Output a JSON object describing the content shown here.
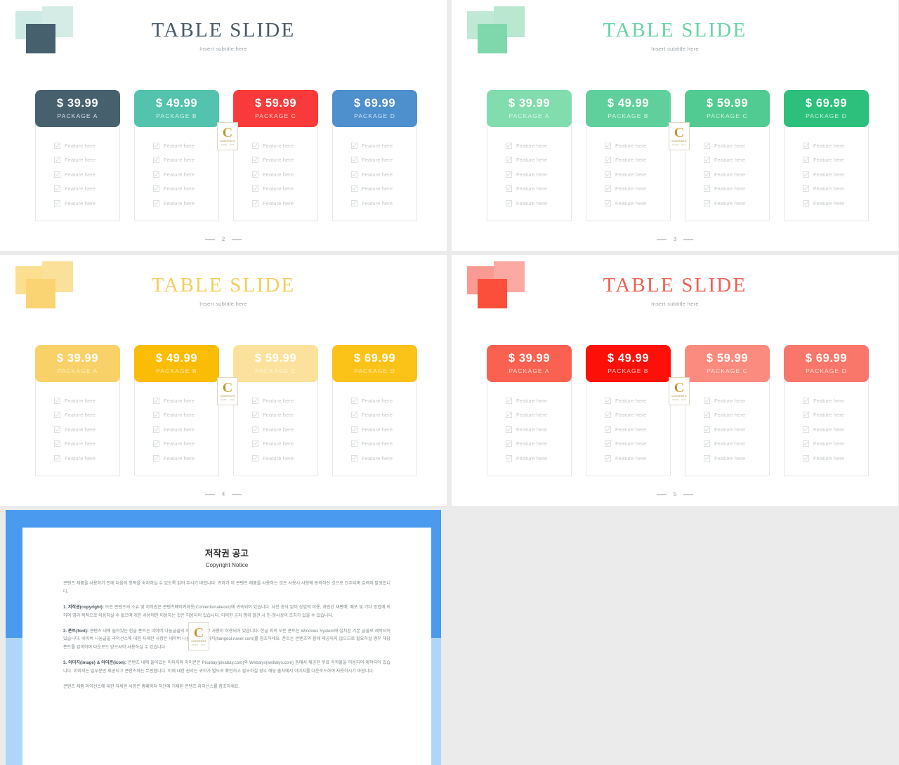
{
  "deck": {
    "subtitle": "Insert subtitle here",
    "title": "TABLE SLIDE",
    "feature_label": "Feature here",
    "watermark": {
      "letter": "C",
      "line1": "CONTENTS",
      "line2": "MAKE · OUT"
    }
  },
  "slides": [
    {
      "id": "slide-2",
      "page": "2",
      "title": "TABLE SLIDE",
      "subtitle": "Insert subtitle here",
      "title_color": "#4a5a66",
      "deco": {
        "a": "#cdeae4",
        "b": "#d5ece6",
        "c": "#47606e"
      },
      "cards": [
        {
          "price": "$ 39.99",
          "package": "PACKAGE  A",
          "bg": "#47606e",
          "pkg_color": "#d8e2e7"
        },
        {
          "price": "$ 49.99",
          "package": "PACKAGE  B",
          "bg": "#53c3ad",
          "pkg_color": "#d9f3ed"
        },
        {
          "price": "$ 59.99",
          "package": "PACKAGE  C",
          "bg": "#f93a3a",
          "pkg_color": "#ffd5d5"
        },
        {
          "price": "$ 69.99",
          "package": "PACKAGE  D",
          "bg": "#4e8fce",
          "pkg_color": "#d6e7f5"
        }
      ],
      "features": [
        "Feature here",
        "Feature here",
        "Feature here",
        "Feature here",
        "Feature here"
      ]
    },
    {
      "id": "slide-3",
      "page": "3",
      "title": "TABLE SLIDE",
      "subtitle": "Insert subtitle here",
      "title_color": "#67d3a4",
      "deco": {
        "a": "#bfe9d4",
        "b": "#b9e7d0",
        "c": "#7fd8ab"
      },
      "cards": [
        {
          "price": "$ 39.99",
          "package": "PACKAGE  A",
          "bg": "#81dcae",
          "pkg_color": "#dcf7ea"
        },
        {
          "price": "$ 49.99",
          "package": "PACKAGE  B",
          "bg": "#5fd09c",
          "pkg_color": "#d8f5e6"
        },
        {
          "price": "$ 59.99",
          "package": "PACKAGE  C",
          "bg": "#51cb92",
          "pkg_color": "#d6f4e2"
        },
        {
          "price": "$ 69.99",
          "package": "PACKAGE  D",
          "bg": "#2cc07c",
          "pkg_color": "#cff0df"
        }
      ],
      "features": [
        "Feature here",
        "Feature here",
        "Feature here",
        "Feature here",
        "Feature here"
      ]
    },
    {
      "id": "slide-4",
      "page": "4",
      "title": "TABLE SLIDE",
      "subtitle": "Insert subtitle here",
      "title_color": "#f5cd5c",
      "deco": {
        "a": "#fbdf8f",
        "b": "#fbe099",
        "c": "#fad472"
      },
      "cards": [
        {
          "price": "$ 39.99",
          "package": "PACKAGE  A",
          "bg": "#f8d268",
          "pkg_color": "#fdeec2"
        },
        {
          "price": "$ 49.99",
          "package": "PACKAGE  B",
          "bg": "#fbbc06",
          "pkg_color": "#fde8b2"
        },
        {
          "price": "$ 59.99",
          "package": "PACKAGE  C",
          "bg": "#fbe19b",
          "pkg_color": "#fef5d9"
        },
        {
          "price": "$ 69.99",
          "package": "PACKAGE  D",
          "bg": "#fbc218",
          "pkg_color": "#fdeab9"
        }
      ],
      "features": [
        "Feature here",
        "Feature here",
        "Feature here",
        "Feature here",
        "Feature here"
      ]
    },
    {
      "id": "slide-5",
      "page": "5",
      "title": "TABLE SLIDE",
      "subtitle": "Insert subtitle here",
      "title_color": "#f06055",
      "deco": {
        "a": "#fa9a93",
        "b": "#fba9a2",
        "c": "#fb4f3c"
      },
      "cards": [
        {
          "price": "$ 39.99",
          "package": "PACKAGE  A",
          "bg": "#fa6151",
          "pkg_color": "#ffd9d3"
        },
        {
          "price": "$ 49.99",
          "package": "PACKAGE  B",
          "bg": "#fc1007",
          "pkg_color": "#ffc9c5"
        },
        {
          "price": "$ 59.99",
          "package": "PACKAGE  C",
          "bg": "#fa8b7e",
          "pkg_color": "#ffe2dc"
        },
        {
          "price": "$ 69.99",
          "package": "PACKAGE  D",
          "bg": "#f9776a",
          "pkg_color": "#ffded8"
        }
      ],
      "features": [
        "Feature here",
        "Feature here",
        "Feature here",
        "Feature here",
        "Feature here"
      ]
    }
  ],
  "copyright": {
    "title": "저작권 공고",
    "subtitle": "Copyright Notice",
    "frame_color_top": "#4a9bf0",
    "frame_color_bottom": "#aed6fb",
    "paragraphs": [
      "콘텐츠 제품을 사용하기 전에 다음의 항목을 숙지하실 수 있도록 읽어 주시기 바랍니다. 귀하가 이 콘텐츠 제품을 사용하는 것은 사용시 사항에 동의하신 것으로 간주되며 효력이 발생합니다.",
      "1. 저작권(copyright): 모든 콘텐츠의 소유 및 저작권은 콘텐츠메이커아웃(Contentsmakeout)에 귀속되어 있습니다. 사전 승낙 없이 상업적 이용, 개인간 재판매, 배포 및 기타 방법에 의하여 영리 목적으로 이용하실 수 없으며 개인 사용에만 이용하는 것은 허용되어 있습니다. 이러한 금지 행위 발견 시 민·형사상의 조치가 있을 수 있습니다.",
      "2. 폰트(font): 콘텐츠 내에 들어있는 한글 폰트는 네이버 나눔글꼴의 저작물로 무료 사용이 허용되어 있습니다. 한글 외의 모든 폰트는 Windows System에 설치된 기본 글꼴로 제작되어 있습니다. 네이버 나눔글꼴 라이선스에 대한 자세한 사항은 네이버 나눔글꼴 홈페이지(hangeul.naver.com)를 참조하세요. 폰트는 콘텐츠와 함께 제공되지 않으므로 필요하실 경우 해당 폰트를 검색하여 다운로드 받으셔야 사용하실 수 있습니다.",
      "3. 이미지(image) & 아이콘(icon): 콘텐츠 내에 들어있는 이미지와 아이콘은 Pixabay(pixabay.com)와 Webalys(webalys.com) 등에서 제공한 무료 저작물을 이용하여 제작되어 있습니다. 이미지는 일부분만 제공되고 콘텐츠와는 무관합니다. 이에 대한 권리는 귀하가 별도로 확인하고 필요하실 경우 해당 출처에서 이미지를 다운로드하여 사용하시기 바랍니다.",
      "콘텐츠 제품 라이선스에 대한 자세한 사항은 홈페이지 하단에 기재된 콘텐츠 라이선스를 참조하세요."
    ],
    "watermark": {
      "letter": "C",
      "line1": "CONTENTS",
      "line2": "MAKE · OUT"
    }
  }
}
